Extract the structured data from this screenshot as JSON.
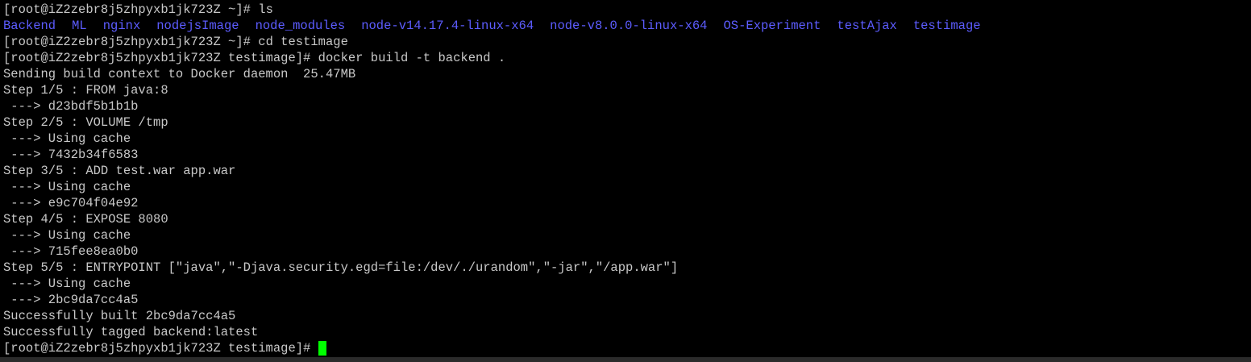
{
  "terminal": {
    "lines": [
      {
        "prompt": "[root@iZ2zebr8j5zhpyxb1jk723Z ~]# ",
        "command": "ls"
      },
      {
        "dirs": [
          "Backend",
          "ML",
          "nginx",
          "nodejsImage",
          "node_modules",
          "node-v14.17.4-linux-x64",
          "node-v8.0.0-linux-x64",
          "OS-Experiment",
          "testAjax",
          "testimage"
        ]
      },
      {
        "prompt": "[root@iZ2zebr8j5zhpyxb1jk723Z ~]# ",
        "command": "cd testimage"
      },
      {
        "prompt": "[root@iZ2zebr8j5zhpyxb1jk723Z testimage]# ",
        "command": "docker build -t backend ."
      },
      {
        "text": "Sending build context to Docker daemon  25.47MB"
      },
      {
        "text": "Step 1/5 : FROM java:8"
      },
      {
        "text": " ---> d23bdf5b1b1b"
      },
      {
        "text": "Step 2/5 : VOLUME /tmp"
      },
      {
        "text": " ---> Using cache"
      },
      {
        "text": " ---> 7432b34f6583"
      },
      {
        "text": "Step 3/5 : ADD test.war app.war"
      },
      {
        "text": " ---> Using cache"
      },
      {
        "text": " ---> e9c704f04e92"
      },
      {
        "text": "Step 4/5 : EXPOSE 8080"
      },
      {
        "text": " ---> Using cache"
      },
      {
        "text": " ---> 715fee8ea0b0"
      },
      {
        "text": "Step 5/5 : ENTRYPOINT [\"java\",\"-Djava.security.egd=file:/dev/./urandom\",\"-jar\",\"/app.war\"]"
      },
      {
        "text": " ---> Using cache"
      },
      {
        "text": " ---> 2bc9da7cc4a5"
      },
      {
        "text": "Successfully built 2bc9da7cc4a5"
      },
      {
        "text": "Successfully tagged backend:latest"
      },
      {
        "prompt": "[root@iZ2zebr8j5zhpyxb1jk723Z testimage]# ",
        "command": "",
        "cursor": true
      }
    ]
  },
  "colors": {
    "background": "#000000",
    "text": "#c8c8c8",
    "directory": "#5c5cff",
    "cursor": "#00ff00"
  }
}
